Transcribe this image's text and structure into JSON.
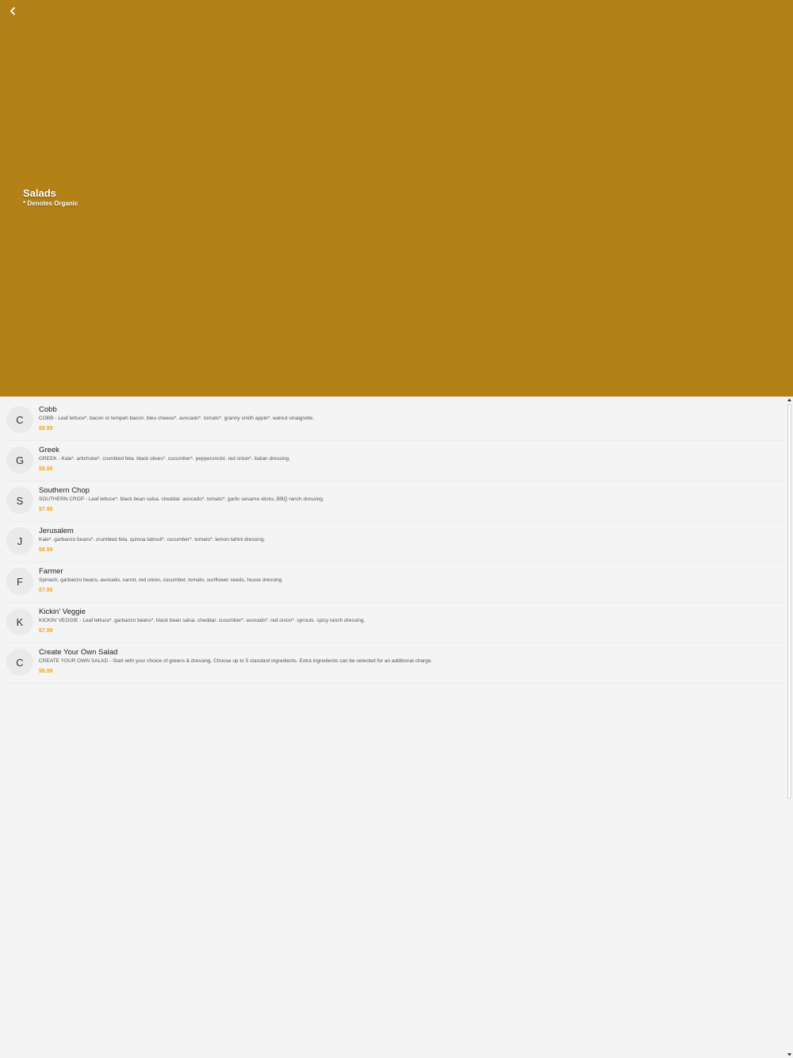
{
  "header": {
    "back_icon": "chevron-left-icon",
    "title": "Salads",
    "subtitle": "* Denotes Organic",
    "background_color": "#b38116"
  },
  "menu": {
    "price_color": "#f0a71e",
    "items": [
      {
        "initial": "C",
        "name": "Cobb",
        "description": "COBB - Leaf lettuce*. bacon or tempeh bacon. bleu cheese*. avocado*. tomato*. granny smith apple*. walnut vinaigrette.",
        "price": "$8.99"
      },
      {
        "initial": "G",
        "name": "Greek",
        "description": "GREEK - Kale*. artichoke*. crumbled feta. black olives*. cucumber*. pepperoncini. red onion*. italian dressing.",
        "price": "$8.99"
      },
      {
        "initial": "S",
        "name": "Southern Chop",
        "description": "SOUTHERN CROP - Leaf lettuce*. black bean salsa. cheddar. avocado*. tomato*. garlic sesame sticks, BBQ ranch dressing.",
        "price": "$7.99"
      },
      {
        "initial": "J",
        "name": "Jerusalem",
        "description": "Kale*. garbanzo beans*. crumbled feta. quinoa tabouli*. cucumber*. tomato*. lemon tahini dressing.",
        "price": "$8.99"
      },
      {
        "initial": "F",
        "name": "Farmer",
        "description": "Spinach, garbanzo beans, avocado, carrot, red onion, cucumber, tomato, sunflower seeds, house dressing",
        "price": "$7.99"
      },
      {
        "initial": "K",
        "name": "Kickin' Veggie",
        "description": "KICKIN' VEGGIE - Leaf lettuce*. garbanzo beans*. black bean salsa. cheddar. cucumber*. avocado*. red onion*. sprouts. spicy ranch dressing.",
        "price": "$7.99"
      },
      {
        "initial": "C",
        "name": "Create Your Own Salad",
        "description": "CREATE YOUR OWN SALAD - Start with your choice of greens & dressing. Choose up to 5 standard ingredients. Extra ingredients can be selected for an additional charge.",
        "price": "$6.99"
      }
    ]
  },
  "scrollbar": {
    "up_icon": "triangle-up-icon",
    "down_icon": "triangle-down-icon"
  }
}
